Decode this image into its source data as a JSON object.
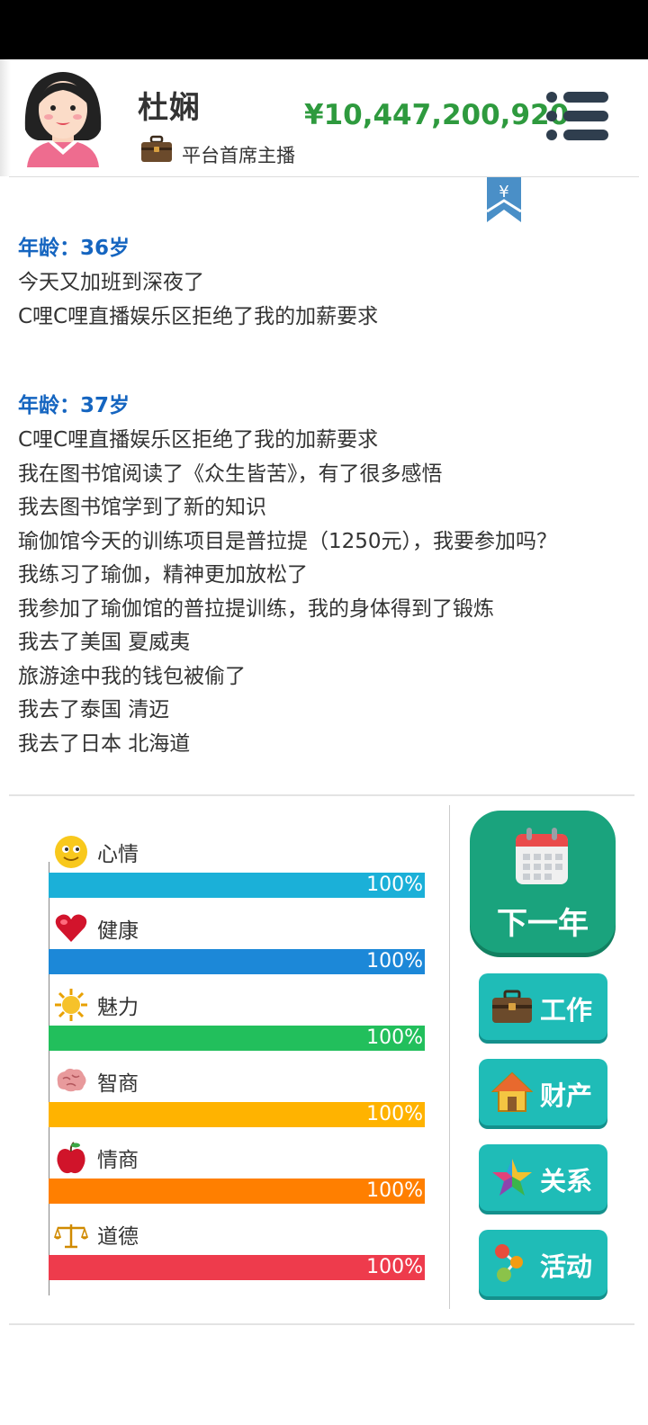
{
  "player": {
    "name": "杜娴",
    "title": "平台首席主播",
    "money": "¥10,447,200,920"
  },
  "log": [
    {
      "age": "年龄：36岁",
      "entries": [
        "今天又加班到深夜了",
        "C哩C哩直播娱乐区拒绝了我的加薪要求"
      ]
    },
    {
      "age": "年龄：37岁",
      "entries": [
        "C哩C哩直播娱乐区拒绝了我的加薪要求",
        "我在图书馆阅读了《众生皆苦》，有了很多感悟",
        "我去图书馆学到了新的知识",
        "瑜伽馆今天的训练项目是普拉提（1250元），我要参加吗？",
        "我练习了瑜伽，精神更加放松了",
        "我参加了瑜伽馆的普拉提训练，我的身体得到了锻炼",
        "我去了美国 夏威夷",
        "旅游途中我的钱包被偷了",
        "我去了泰国 清迈",
        "我去了日本 北海道"
      ]
    }
  ],
  "stats": [
    {
      "label": "心情",
      "pct_text": "100%",
      "value": 1.0,
      "color": "#1bb0d8",
      "icon": "smiley-face-icon"
    },
    {
      "label": "健康",
      "pct_text": "100%",
      "value": 1.0,
      "color": "#1c88d8",
      "icon": "heart-icon"
    },
    {
      "label": "魅力",
      "pct_text": "100%",
      "value": 1.0,
      "color": "#22bf5c",
      "icon": "sun-icon"
    },
    {
      "label": "智商",
      "pct_text": "100%",
      "value": 1.0,
      "color": "#ffb300",
      "icon": "brain-icon"
    },
    {
      "label": "情商",
      "pct_text": "100%",
      "value": 1.0,
      "color": "#ff7f00",
      "icon": "apple-icon"
    },
    {
      "label": "道德",
      "pct_text": "100%",
      "value": 1.0,
      "color": "#ee3b4c",
      "icon": "scales-icon"
    }
  ],
  "actions": {
    "next_year": "下一年",
    "work": "工作",
    "property": "财产",
    "relations": "关系",
    "activities": "活动"
  },
  "icons": {
    "avatar": "woman-avatar-icon",
    "job": "briefcase-icon",
    "menu": "menu-list-icon",
    "bookmark": "yen-bookmark-icon",
    "next_year": "calendar-icon",
    "work": "briefcase-icon",
    "property": "house-icon",
    "relations": "star-icon",
    "activities": "activity-dots-icon"
  },
  "colors": {
    "money": "#2e9a3e",
    "age": "#1565c0",
    "next_button": "#1aa37d",
    "side_button": "#1fbcb7"
  },
  "bookmark_symbol": "¥"
}
